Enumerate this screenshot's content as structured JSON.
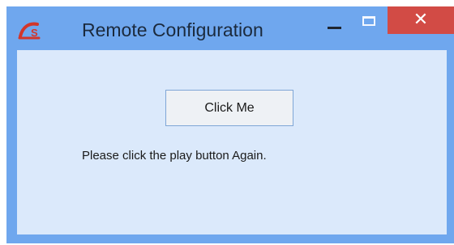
{
  "window": {
    "title": "Remote Configuration",
    "icon": "app-logo-icon",
    "close_glyph": "✕"
  },
  "content": {
    "button_label": "Click Me",
    "message": "Please click the play button Again."
  },
  "colors": {
    "frame": "#6fa7ee",
    "client_background": "#dbe9fb",
    "close_button": "#d24b45",
    "logo_red": "#d2362b"
  }
}
